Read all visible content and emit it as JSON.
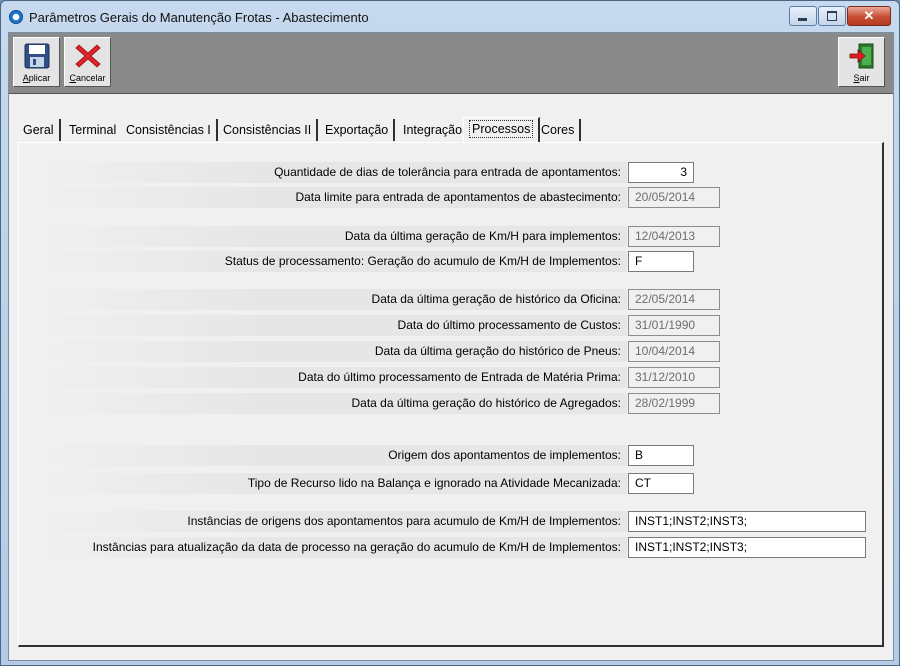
{
  "window": {
    "title": "Parâmetros Gerais do Manutenção Frotas - Abastecimento",
    "close_glyph": "✕"
  },
  "toolbar": {
    "apply": {
      "label_mnemonic": "A",
      "label_rest": "plicar",
      "icon": "floppy-disk-icon"
    },
    "cancel": {
      "label_mnemonic": "C",
      "label_rest": "ancelar",
      "icon": "red-x-icon"
    },
    "exit": {
      "label_mnemonic": "S",
      "label_rest": "air",
      "icon": "exit-door-icon"
    }
  },
  "tabs": [
    {
      "label": "Geral"
    },
    {
      "label": "Terminal"
    },
    {
      "label": "Consistências I"
    },
    {
      "label": "Consistências II"
    },
    {
      "label": "Exportação"
    },
    {
      "label": "Integração"
    },
    {
      "label": "Processos",
      "active": true
    },
    {
      "label": "Cores"
    }
  ],
  "processos": {
    "rows": [
      {
        "label": "Quantidade de dias de tolerância para entrada de apontamentos:",
        "value": "3"
      },
      {
        "label": "Data limite para entrada de apontamentos de abastecimento:",
        "value": "20/05/2014"
      },
      {
        "label": "Data da última geração de Km/H para implementos:",
        "value": "12/04/2013"
      },
      {
        "label": "Status de processamento: Geração do acumulo de Km/H de Implementos:",
        "value": "F"
      },
      {
        "label": "Data da última geração de histórico da Oficina:",
        "value": "22/05/2014"
      },
      {
        "label": "Data do último processamento de Custos:",
        "value": "31/01/1990"
      },
      {
        "label": "Data da última geração do histórico de Pneus:",
        "value": "10/04/2014"
      },
      {
        "label": "Data do último processamento de Entrada de Matéria Prima:",
        "value": "31/12/2010"
      },
      {
        "label": "Data da última geração do histórico de Agregados:",
        "value": "28/02/1999"
      },
      {
        "label": "Origem dos apontamentos de implementos:",
        "value": "B"
      },
      {
        "label": "Tipo de Recurso lido na Balança e ignorado na Atividade Mecanizada:",
        "value": "CT"
      },
      {
        "label": "Instâncias de origens dos apontamentos para acumulo de Km/H de Implementos:",
        "value": "INST1;INST2;INST3;"
      },
      {
        "label": "Instâncias para atualização da data de processo na geração do acumulo de Km/H de Implementos:",
        "value": "INST1;INST2;INST3;"
      }
    ]
  }
}
